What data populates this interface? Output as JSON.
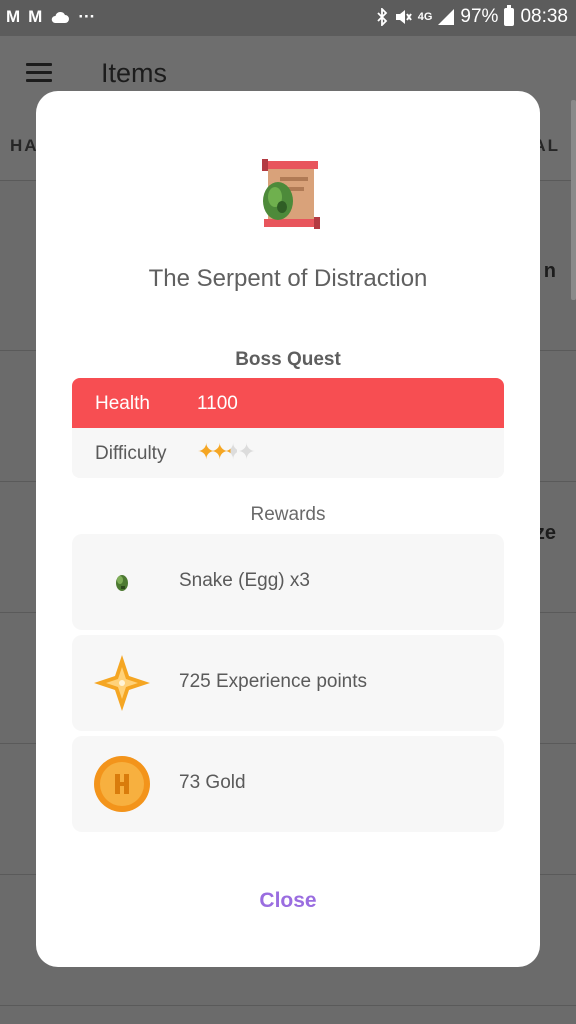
{
  "status_bar": {
    "left_icons": [
      "gmail-icon",
      "gmail-icon",
      "cloud-icon",
      "more-icon"
    ],
    "network": "4G",
    "battery": "97%",
    "time": "08:38"
  },
  "app_bar": {
    "title": "Items"
  },
  "tabs": {
    "left_partial": "HA",
    "right_partial": "AL"
  },
  "background_rows": [
    {
      "edge_text": "n"
    },
    {
      "edge_text": ""
    },
    {
      "edge_text": "ze"
    },
    {
      "edge_text": ""
    },
    {
      "edge_text": ""
    },
    {
      "edge_text": ""
    }
  ],
  "dialog": {
    "icon": "quest-scroll-icon",
    "title": "The Serpent of Distraction",
    "boss_section_label": "Boss Quest",
    "health_label": "Health",
    "health_value": "1100",
    "difficulty_label": "Difficulty",
    "difficulty_stars": 2.5,
    "difficulty_max": 4,
    "rewards_label": "Rewards",
    "rewards": [
      {
        "icon": "snake-egg-icon",
        "label": "Snake (Egg) x3"
      },
      {
        "icon": "experience-star-icon",
        "label": "725 Experience points"
      },
      {
        "icon": "gold-coin-icon",
        "label": "73 Gold"
      }
    ],
    "close_label": "Close"
  },
  "colors": {
    "health_red": "#f74e52",
    "accent_purple": "#9a6de0",
    "star_gold": "#f5a623"
  }
}
